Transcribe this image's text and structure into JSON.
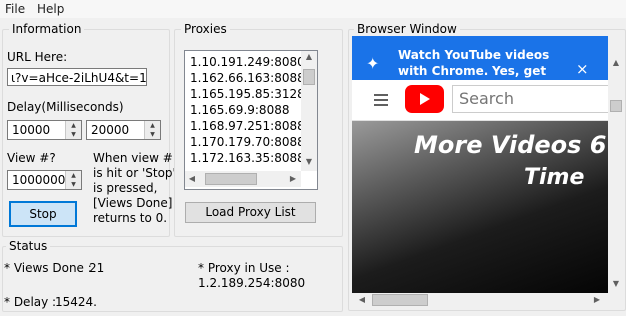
{
  "menu": {
    "file": "File",
    "help": "Help"
  },
  "information": {
    "legend": "Information",
    "url_label": "URL Here:",
    "url_value": "ι?v=aHce-2iLhU4&t=1s",
    "delay_label": "Delay(Milliseconds)",
    "delay_min": "10000",
    "delay_max": "20000",
    "view_label": "View #?",
    "view_value": "1000000",
    "view_note_1": "When view #",
    "view_note_2": "is hit or 'Stop'",
    "view_note_3": "is pressed,",
    "view_note_4": "[Views Done]",
    "view_note_5": "returns to 0.",
    "stop_button": "Stop"
  },
  "proxies": {
    "legend": "Proxies",
    "items": [
      "1.10.191.249:8080",
      "1.162.66.163:8088",
      "1.165.195.85:3128",
      "1.165.69.9:8088",
      "1.168.97.251:8088",
      "1.170.179.70:8088",
      "1.172.163.35:8088"
    ],
    "load_button": "Load Proxy List"
  },
  "browser": {
    "legend": "Browser Window",
    "notif_line1": "Watch YouTube videos",
    "notif_line2": "with Chrome.",
    "notif_yes": "Yes, get",
    "notif_close": "×",
    "search_placeholder": "Search",
    "video_line1": "More Videos 6",
    "video_line2": "Time"
  },
  "status": {
    "legend": "Status",
    "views_done_label": "* Views Done :",
    "views_done_value": "21",
    "proxy_label": "* Proxy in Use :",
    "proxy_value": "1.2.189.254:8080",
    "delay_label": "* Delay :",
    "delay_value": "15424."
  },
  "colors": {
    "accent": "#0078d7",
    "notif_bg": "#1a73e8",
    "youtube_red": "#ff0000"
  }
}
